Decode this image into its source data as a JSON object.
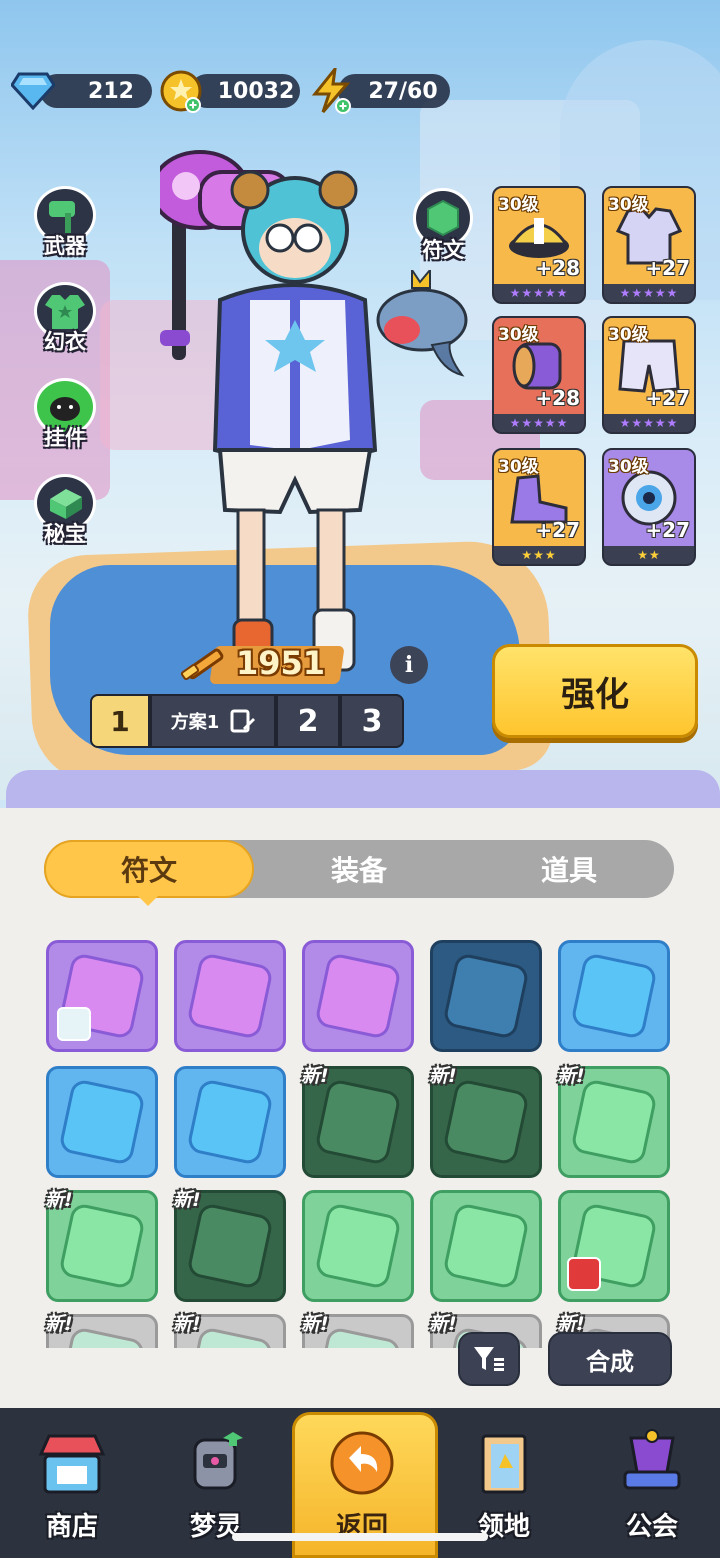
{
  "currencies": [
    {
      "name": "diamond-icon",
      "value": "212",
      "color": "#5ab8f0"
    },
    {
      "name": "coin-icon",
      "value": "10032",
      "color": "#f5c22a"
    },
    {
      "name": "energy-icon",
      "value": "27/60",
      "color": "#f5c22a"
    }
  ],
  "side_menu": [
    {
      "label": "武器",
      "icon": "hammer-icon"
    },
    {
      "label": "幻衣",
      "icon": "shirt-icon"
    },
    {
      "label": "挂件",
      "icon": "pendant-icon"
    },
    {
      "label": "秘宝",
      "icon": "treasure-icon"
    }
  ],
  "rune_button": {
    "label": "符文",
    "icon": "hexagon-gem-icon"
  },
  "equipment": [
    {
      "level": "30级",
      "plus": "+28",
      "stars": "★★★★★",
      "star_color": "#b07cff",
      "bg": "#f6b94a",
      "icon": "hat-icon"
    },
    {
      "level": "30级",
      "plus": "+27",
      "stars": "★★★★★",
      "star_color": "#b07cff",
      "bg": "#f6b94a",
      "icon": "jacket-icon"
    },
    {
      "level": "30级",
      "plus": "+28",
      "stars": "★★★★★",
      "star_color": "#b07cff",
      "bg": "#e7705a",
      "icon": "bracer-icon"
    },
    {
      "level": "30级",
      "plus": "+27",
      "stars": "★★★★★",
      "star_color": "#b07cff",
      "bg": "#f6b94a",
      "icon": "pants-icon"
    },
    {
      "level": "30级",
      "plus": "+27",
      "stars": "★★★",
      "star_color": "#ffcf3a",
      "bg": "#f6b94a",
      "icon": "shoe-icon"
    },
    {
      "level": "30级",
      "plus": "+27",
      "stars": "★★",
      "star_color": "#ffcf3a",
      "bg": "#a88ae8",
      "icon": "eye-orb-icon"
    }
  ],
  "power": "1951",
  "info_label": "i",
  "plans": {
    "slot1": "1",
    "name": "方案1",
    "slot2": "2",
    "slot3": "3"
  },
  "strengthen_label": "强化",
  "tabs": [
    {
      "label": "符文",
      "active": true
    },
    {
      "label": "装备",
      "active": false
    },
    {
      "label": "道具",
      "active": false
    }
  ],
  "inventory": [
    {
      "rarity": "purple",
      "new": false,
      "badge": "avatar-badge-icon"
    },
    {
      "rarity": "purple",
      "new": false
    },
    {
      "rarity": "purple",
      "new": false
    },
    {
      "rarity": "blue-dim",
      "new": false
    },
    {
      "rarity": "blue",
      "new": false
    },
    {
      "rarity": "blue",
      "new": false
    },
    {
      "rarity": "blue",
      "new": false
    },
    {
      "rarity": "green-dim",
      "new": true
    },
    {
      "rarity": "green-dim",
      "new": true
    },
    {
      "rarity": "green",
      "new": true
    },
    {
      "rarity": "green",
      "new": true
    },
    {
      "rarity": "green-dim",
      "new": true
    },
    {
      "rarity": "green",
      "new": false
    },
    {
      "rarity": "green",
      "new": false
    },
    {
      "rarity": "green",
      "new": false,
      "badge": "red-face-badge-icon"
    },
    {
      "rarity": "grey",
      "new": true
    },
    {
      "rarity": "grey",
      "new": true
    },
    {
      "rarity": "grey",
      "new": true
    },
    {
      "rarity": "grey",
      "new": true
    },
    {
      "rarity": "grey",
      "new": true
    }
  ],
  "new_tag": "新!",
  "craft_label": "合成",
  "nav": [
    {
      "label": "商店",
      "icon": "shop-icon",
      "active": false
    },
    {
      "label": "梦灵",
      "icon": "robot-icon",
      "active": false
    },
    {
      "label": "返回",
      "icon": "return-arrow-icon",
      "active": true
    },
    {
      "label": "领地",
      "icon": "door-icon",
      "active": false
    },
    {
      "label": "公会",
      "icon": "guild-hat-icon",
      "active": false
    }
  ]
}
